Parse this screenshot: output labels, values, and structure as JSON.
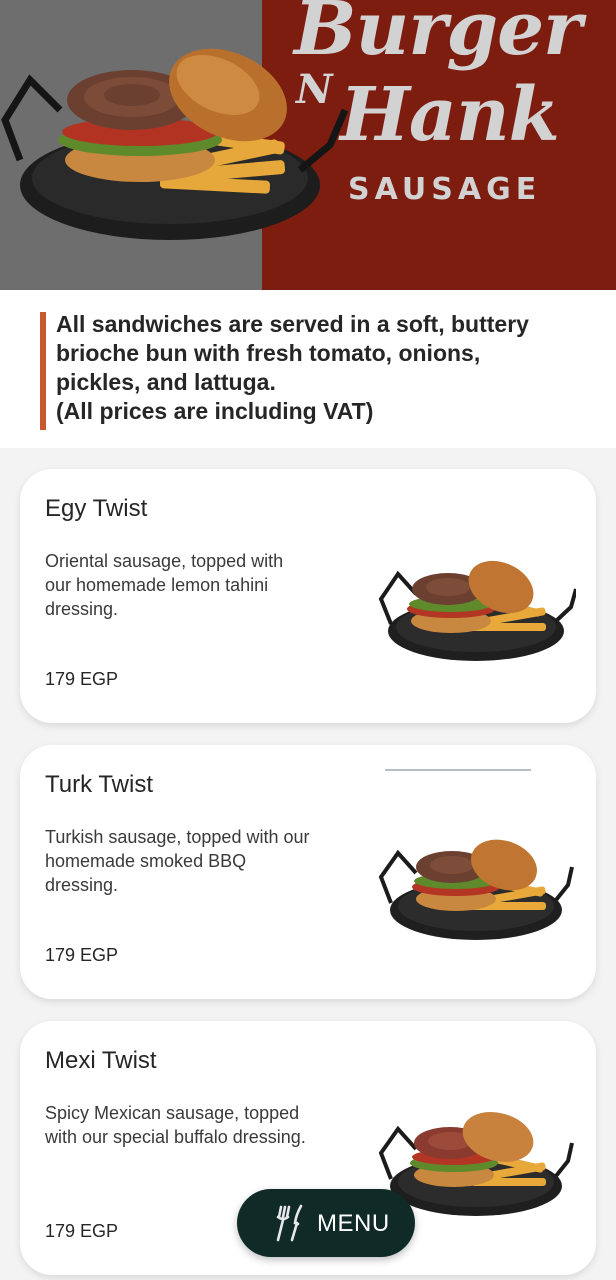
{
  "brand": {
    "line1": "Burger",
    "n": "N",
    "line2": "Hank",
    "line3": "SAUSAGE"
  },
  "notice": {
    "lines": [
      "All sandwiches are served in a soft, buttery",
      "brioche bun with fresh tomato, onions,",
      "pickles, and lattuga.",
      "(All prices are including VAT)"
    ]
  },
  "items": [
    {
      "title": "Egy Twist",
      "desc_lines": [
        "Oriental sausage, topped with",
        "our homemade lemon tahini",
        "dressing."
      ],
      "price": "179 EGP"
    },
    {
      "title": "Turk Twist",
      "desc_lines": [
        "Turkish sausage, topped with our",
        "homemade smoked BBQ",
        "dressing."
      ],
      "price": "179 EGP"
    },
    {
      "title": "Mexi Twist",
      "desc_lines": [
        "Spicy Mexican sausage, topped",
        "with our special buffalo dressing."
      ],
      "price": "179 EGP"
    }
  ],
  "menu_button": {
    "label": "MENU",
    "icon": "fork-knife-icon"
  },
  "colors": {
    "hero_gray": "#6e6e6e",
    "hero_red": "#7d1d10",
    "accent_bar": "#c65a2e",
    "menu_button_bg": "#0f2a27"
  }
}
